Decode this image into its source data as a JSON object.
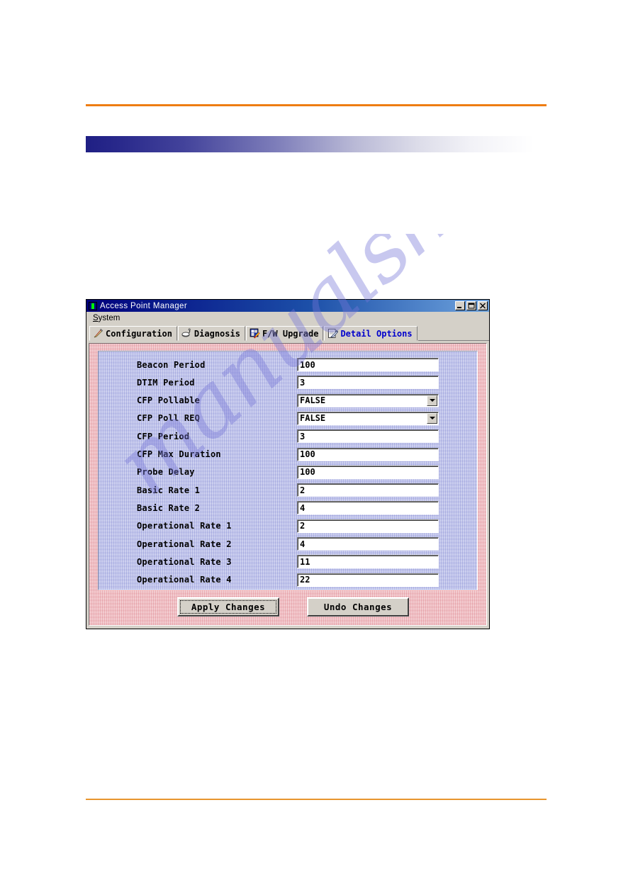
{
  "page": {
    "watermark_text": "manualshive.com"
  },
  "window": {
    "title": "Access Point Manager",
    "icon": "app-icon",
    "controls": [
      {
        "name": "minimize-button",
        "glyph": "minimize-icon"
      },
      {
        "name": "maximize-button",
        "glyph": "maximize-icon"
      },
      {
        "name": "close-button",
        "glyph": "close-icon"
      }
    ],
    "menu": [
      {
        "label": "System",
        "accel": "S"
      }
    ],
    "tabs": [
      {
        "label": "Configuration",
        "icon": "pencil-icon",
        "active": false
      },
      {
        "label": "Diagnosis",
        "icon": "stethoscope-icon",
        "active": false
      },
      {
        "label": "F/W Upgrade",
        "icon": "firmware-chip-icon",
        "active": false
      },
      {
        "label": "Detail Options",
        "icon": "note-pencil-icon",
        "active": true
      }
    ]
  },
  "form": {
    "fields": [
      {
        "label": "Beacon Period",
        "value": "100",
        "type": "text"
      },
      {
        "label": "DTIM Period",
        "value": "3",
        "type": "text"
      },
      {
        "label": "CFP Pollable",
        "value": "FALSE",
        "type": "combo"
      },
      {
        "label": "CFP Poll REQ",
        "value": "FALSE",
        "type": "combo"
      },
      {
        "label": "CFP Period",
        "value": "3",
        "type": "text"
      },
      {
        "label": "CFP Max Duration",
        "value": "100",
        "type": "text"
      },
      {
        "label": "Probe Delay",
        "value": "100",
        "type": "text"
      },
      {
        "label": "Basic Rate 1",
        "value": "2",
        "type": "text"
      },
      {
        "label": "Basic Rate 2",
        "value": "4",
        "type": "text"
      },
      {
        "label": "Operational Rate 1",
        "value": "2",
        "type": "text"
      },
      {
        "label": "Operational Rate 2",
        "value": "4",
        "type": "text"
      },
      {
        "label": "Operational Rate 3",
        "value": "11",
        "type": "text"
      },
      {
        "label": "Operational Rate 4",
        "value": "22",
        "type": "text"
      }
    ]
  },
  "buttons": {
    "apply": "Apply Changes",
    "undo": "Undo Changes"
  },
  "colors": {
    "accent_orange": "#ee7d12",
    "gradient_start": "#1f1f84",
    "gradient_end": "#ffffff",
    "active_tab_text": "#0000cc",
    "dialog_face": "#d4d0c8",
    "pink_panel": "#f3cfd3",
    "blue_panel": "#ccd0f0",
    "watermark": "#7676d6"
  }
}
